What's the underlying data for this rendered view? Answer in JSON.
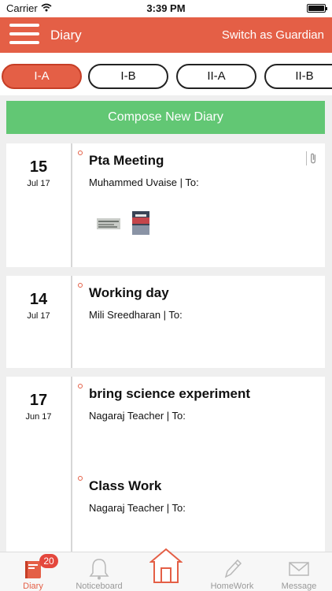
{
  "status": {
    "carrier": "Carrier",
    "time": "3:39 PM"
  },
  "header": {
    "title": "Diary",
    "switch_label": "Switch as Guardian"
  },
  "tabs": [
    {
      "label": "I-A",
      "active": true
    },
    {
      "label": "I-B"
    },
    {
      "label": "II-A"
    },
    {
      "label": "II-B"
    }
  ],
  "compose_label": "Compose New Diary",
  "diary": [
    {
      "day": "15",
      "month": "Jul 17",
      "entries": [
        {
          "title": "Pta Meeting",
          "meta": "Muhammed Uvaise | To:"
        }
      ],
      "has_attachment": true
    },
    {
      "day": "14",
      "month": "Jul 17",
      "entries": [
        {
          "title": "Working day",
          "meta": "Mili Sreedharan | To:"
        }
      ]
    },
    {
      "day": "17",
      "month": "Jun 17",
      "entries": [
        {
          "title": "bring science experiment",
          "meta": "Nagaraj Teacher | To:"
        },
        {
          "title": "Class Work",
          "meta": "Nagaraj Teacher | To:"
        }
      ]
    }
  ],
  "bottom_nav": {
    "diary": "Diary",
    "diary_badge": "20",
    "noticeboard": "Noticeboard",
    "homework": "HomeWork",
    "message": "Message"
  },
  "colors": {
    "primary": "#e45f46",
    "compose": "#62c774"
  }
}
